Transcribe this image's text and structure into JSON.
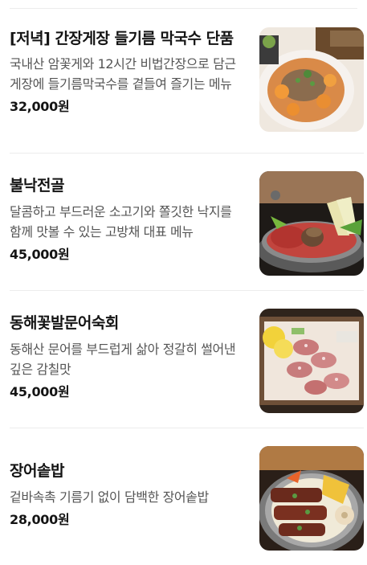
{
  "menu": {
    "items": [
      {
        "name": "[저녁] 간장게장 들기름 막국수 단품",
        "description": "국내산 암꽃게와 12시간 비법간장으로 담근 게장에 들기름막국수를 곁들여 즐기는 메뉴",
        "price": "32,000원",
        "image": "dish-photo-crab-noodles"
      },
      {
        "name": "불낙전골",
        "description": "달콤하고 부드러운 소고기와 쫄깃한 낙지를 함께 맛볼 수 있는 고방채 대표 메뉴",
        "price": "45,000원",
        "image": "dish-photo-hotpot"
      },
      {
        "name": "동해꽃발문어숙회",
        "description": "동해산 문어를 부드럽게 삶아 정갈히 썰어낸 깊은 감칠맛",
        "price": "45,000원",
        "image": "dish-photo-octopus"
      },
      {
        "name": "장어솥밥",
        "description": "겉바속촉 기름기 없이 담백한 장어솥밥",
        "price": "28,000원",
        "image": "dish-photo-eel-rice"
      }
    ]
  }
}
